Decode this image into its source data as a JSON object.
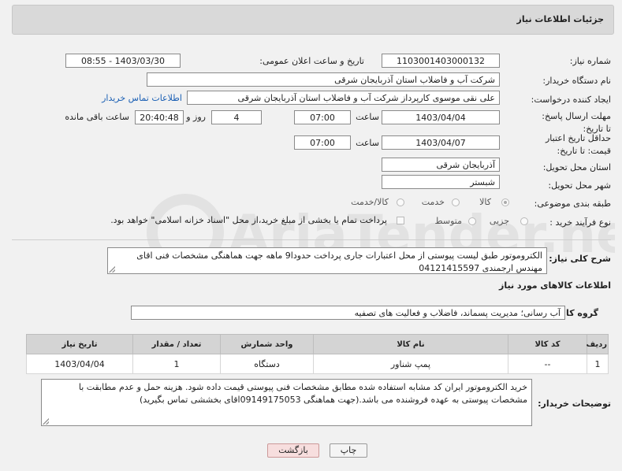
{
  "header": {
    "title": "جزئیات اطلاعات نیاز"
  },
  "form": {
    "need_number_label": "شماره نیاز:",
    "need_number": "1103001403000132",
    "announce_label": "تاریخ و ساعت اعلان عمومی:",
    "announce_value": "1403/03/30 - 08:55",
    "buyer_org_label": "نام دستگاه خریدار:",
    "buyer_org": "شرکت آب و فاضلاب استان آذربایجان شرقی",
    "requester_label": "ایجاد کننده درخواست:",
    "requester": "علی نقی موسوی کارپرداز شرکت آب و فاضلاب استان آذربایجان شرقی",
    "contact_link": "اطلاعات تماس خریدار",
    "reply_deadline_label": "مهلت ارسال پاسخ: تا تاریخ:",
    "reply_date": "1403/04/04",
    "hour_label": "ساعت",
    "reply_time": "07:00",
    "days_value": "4",
    "days_label": "روز و",
    "remaining_time": "20:40:48",
    "remaining_label": "ساعت باقی مانده",
    "validity_label": "حداقل تاریخ اعتبار قیمت: تا تاریخ:",
    "validity_date": "1403/04/07",
    "validity_time": "07:00",
    "province_label": "استان محل تحویل:",
    "province": "آذربایجان شرقی",
    "city_label": "شهر محل تحویل:",
    "city": "شبستر",
    "category_label": "طبقه بندی موضوعی:",
    "category_options": [
      "کالا",
      "خدمت",
      "کالا/خدمت"
    ],
    "process_label": "نوع فرآیند خرید :",
    "process_options": [
      "جزیی",
      "متوسط"
    ],
    "payment_note": "پرداخت تمام یا بخشی از مبلغ خرید،از محل \"اسناد خزانه اسلامی\" خواهد بود."
  },
  "description": {
    "label": "شرح کلی نیاز:",
    "text": "الکتروموتور طبق لیست پیوستی از محل اعتبارات جاری پرداخت حدودا9 ماهه جهت هماهنگی مشخصات فنی اقای مهندس ارجمندی 04121415597"
  },
  "goods_section": {
    "title": "اطلاعات کالاهای مورد نیاز",
    "group_label": "گروه کالا:",
    "group_value": "آب رسانی؛ مدیریت پسماند، فاضلاب و فعالیت های تصفیه"
  },
  "table": {
    "headers": [
      "ردیف",
      "کد کالا",
      "نام کالا",
      "واحد شمارش",
      "تعداد / مقدار",
      "تاریخ نیاز"
    ],
    "rows": [
      [
        "1",
        "--",
        "پمپ شناور",
        "دستگاه",
        "1",
        "1403/04/04"
      ]
    ]
  },
  "buyer_notes": {
    "label": "توضیحات خریدار:",
    "text": "خرید الکتروموتور     ایران کد مشابه استفاده شده مطابق مشخصات فنی پیوستی قیمت داده شود. هزینه حمل و عدم مطابقت با مشخصات پیوستی به عهده فروشنده می باشد.(جهت هماهنگی 09149175053اقای بخششی تماس بگیرید)"
  },
  "buttons": {
    "print": "چاپ",
    "back": "بازگشت"
  },
  "watermark": {
    "text": "AriaTender.neT"
  }
}
